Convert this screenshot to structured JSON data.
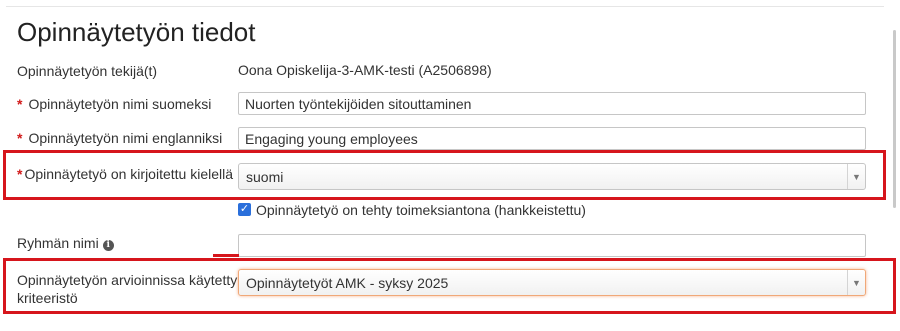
{
  "page_title": "Opinnäytetyön tiedot",
  "fields": {
    "authors": {
      "label": "Opinnäytetyön tekijä(t)",
      "value": "Oona Opiskelija-3-AMK-testi (A2506898)"
    },
    "name_fi": {
      "label": "Opinnäytetyön nimi suomeksi",
      "value": "Nuorten työntekijöiden sitouttaminen",
      "required_mark": "*"
    },
    "name_en": {
      "label": "Opinnäytetyön nimi englanniksi",
      "value": "Engaging young employees",
      "required_mark": "*"
    },
    "language": {
      "label": "Opinnäytetyö on kirjoitettu kielellä",
      "value": "suomi",
      "required_mark": "*"
    },
    "commissioned": {
      "label": "Opinnäytetyö on tehty toimeksiantona (hankkeistettu)",
      "checked": true
    },
    "group_name": {
      "label": "Ryhmän nimi",
      "value": ""
    },
    "criteria": {
      "label_line1": "Opinnäytetyön arvioinnissa käytetty",
      "label_line2": "kriteeristö",
      "value": "Opinnäytetyöt AMK - syksy 2025"
    }
  },
  "icons": {
    "dropdown": "triangle-down-icon",
    "info": "info-circle-icon",
    "checkbox": "check-icon"
  },
  "colors": {
    "required": "#d11a1a",
    "highlight": "#d6151c",
    "focus": "#f0a878",
    "checkbox": "#2a6fdb"
  }
}
